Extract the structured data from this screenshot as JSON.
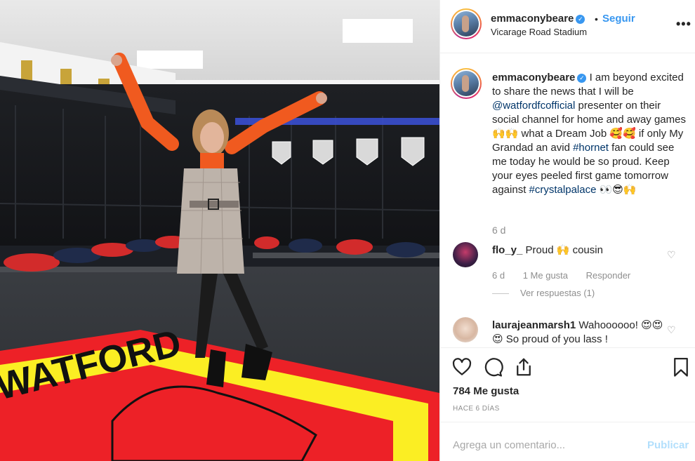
{
  "post": {
    "username": "emmaconybeare",
    "follow_label": "Seguir",
    "separator": "•",
    "location": "Vicarage Road Stadium",
    "more_label": "•••"
  },
  "caption": {
    "username": "emmaconybeare",
    "text_1": " I am beyond excited to share the news that I will be ",
    "mention": "@watfordfcofficial",
    "text_2": " presenter on their social channel for home and away games🙌🙌 what a Dream Job 🥰🥰 if only My Grandad an avid ",
    "hashtag_1": "#hornet",
    "text_3": " fan could see me today he would be so proud. Keep your eyes peeled first game tomorrow against ",
    "hashtag_2": "#crystalpalace",
    "text_4": " 👀😎🙌",
    "time": "6 d"
  },
  "comments": [
    {
      "username": "flo_y_",
      "text": " Proud 🙌 cousin",
      "time": "6 d",
      "likes": "1 Me gusta",
      "reply": "Responder",
      "view_replies": "Ver respuestas (1)"
    },
    {
      "username": "laurajeanmarsh1",
      "text": " Wahoooooo! 😍😍😍 So proud of you lass !"
    }
  ],
  "actions": {
    "likes_count": "784 Me gusta",
    "time_ago": "HACE 6 DÍAS"
  },
  "add_comment": {
    "placeholder": "Agrega un comentario...",
    "post_label": "Publicar"
  },
  "photo": {
    "crest_text": "WATFORD",
    "kit_text": "WATFORD"
  },
  "colors": {
    "accent_blue": "#3897f0",
    "link_navy": "#003569",
    "muted": "#8e8e8e",
    "watford_yellow": "#fbee23",
    "watford_red": "#ed2127"
  },
  "icons": [
    "verified-icon",
    "more-icon",
    "heart-icon",
    "comment-icon",
    "share-icon",
    "bookmark-icon"
  ]
}
